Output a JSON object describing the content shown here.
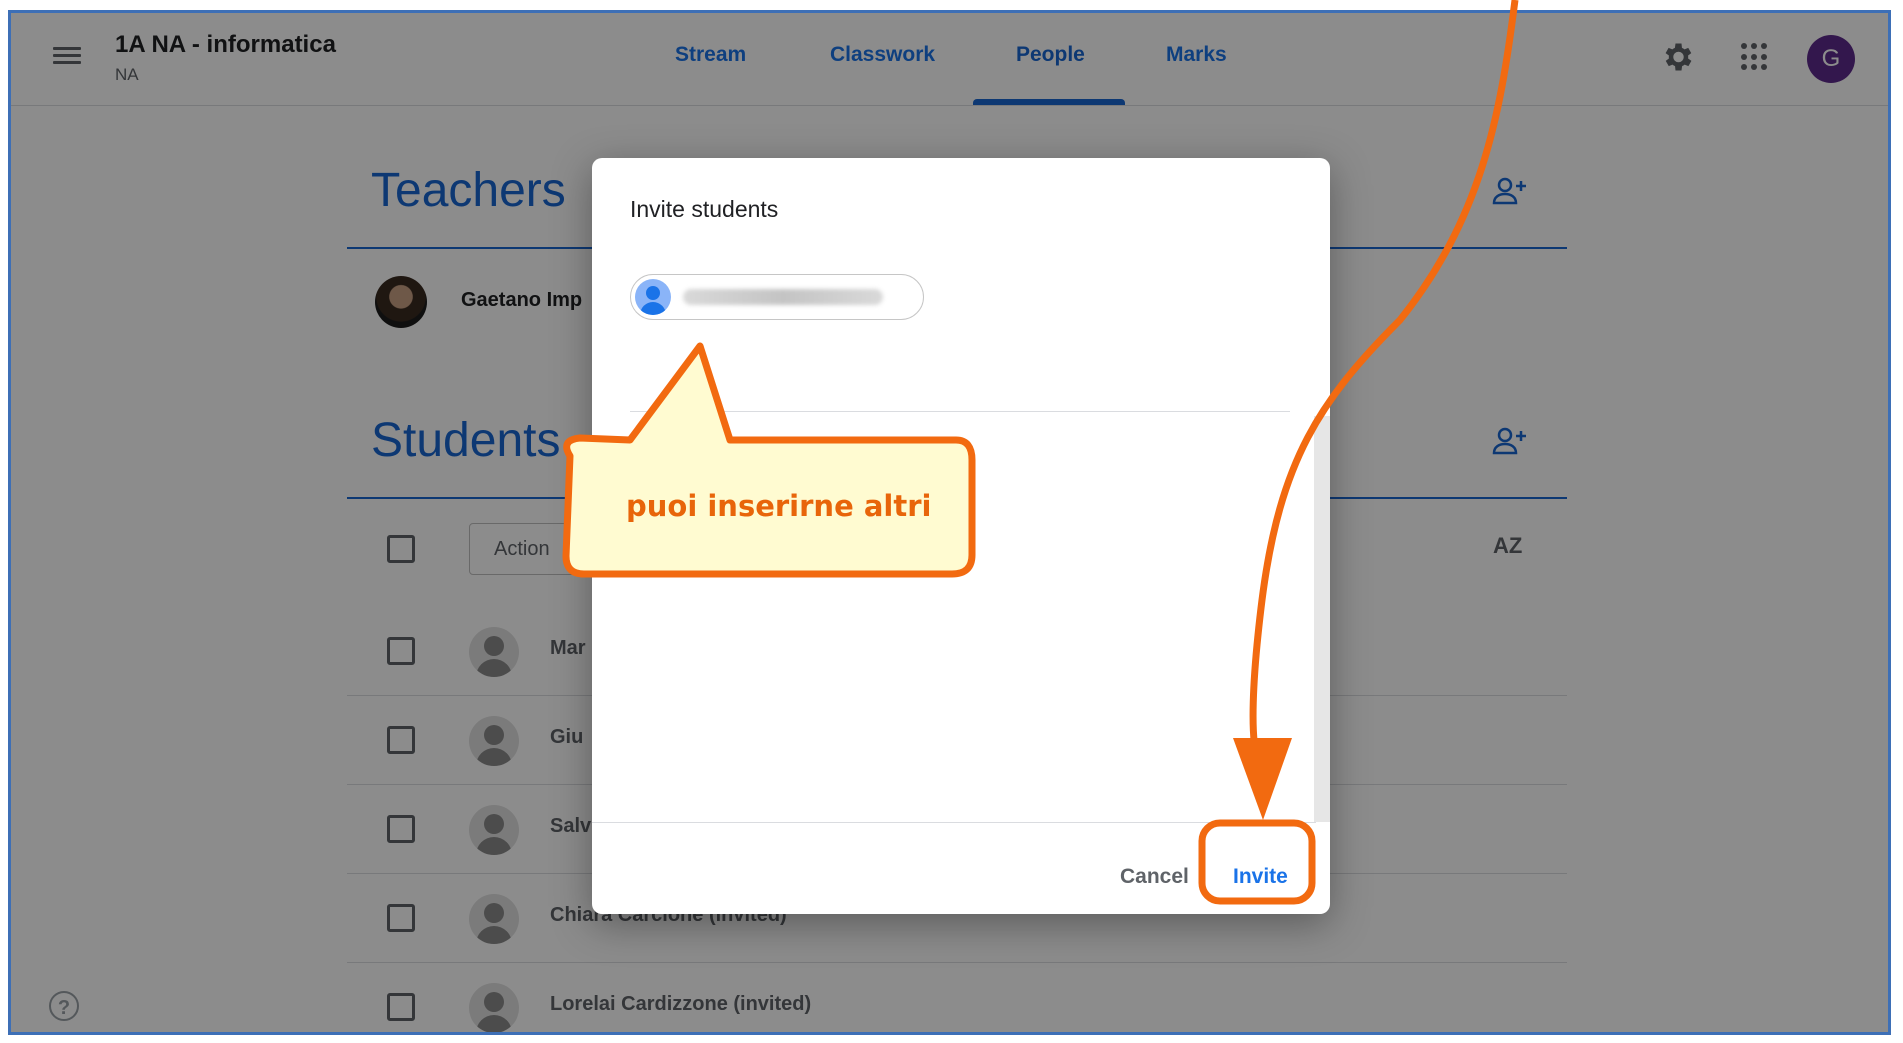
{
  "header": {
    "class_title": "1A NA - informatica",
    "class_section": "NA",
    "tabs": [
      {
        "label": "Stream"
      },
      {
        "label": "Classwork"
      },
      {
        "label": "People"
      },
      {
        "label": "Marks"
      }
    ],
    "active_tab": "People",
    "user_initial": "G",
    "icons": [
      "menu-icon",
      "gear-icon",
      "apps-grid-icon"
    ]
  },
  "people": {
    "teachers_title": "Teachers",
    "teacher_name": "Gaetano Imp",
    "students_title": "Students",
    "actions_label": "Action",
    "sort_label": "AZ",
    "students": [
      {
        "name": "Mar"
      },
      {
        "name": "Giu"
      },
      {
        "name": "Salv"
      },
      {
        "name": "Chiara Carcione  (invited)"
      },
      {
        "name": "Lorelai Cardizzone  (invited)"
      }
    ]
  },
  "dialog": {
    "title": "Invite students",
    "cancel_label": "Cancel",
    "invite_label": "Invite"
  },
  "annotation": {
    "callout_text": "puoi inserirne altri",
    "accent_color": "#f26a10",
    "callout_fill": "#fffbd1"
  },
  "colors": {
    "brand_blue": "#1967d2",
    "frame_border": "#3d6fb6",
    "avatar_bg": "#5e2a8c"
  }
}
